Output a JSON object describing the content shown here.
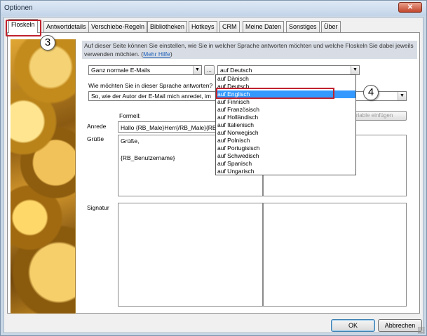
{
  "window": {
    "title": "Optionen",
    "close_glyph": "✕"
  },
  "tabs": [
    "Floskeln",
    "Antwortdetails",
    "Verschiebe-Regeln",
    "Bibliotheken",
    "Hotkeys",
    "CRM",
    "Meine Daten",
    "Sonstiges",
    "Über"
  ],
  "active_tab": "Floskeln",
  "callouts": {
    "step3": "3",
    "step4": "4"
  },
  "info": {
    "text": "Auf dieser Seite können Sie einstellen, wie Sie in welcher Sprache antworten möchten und welche Floskeln Sie dabei jeweils verwenden möchten.",
    "link": "Mehr Hilfe"
  },
  "style_combo": {
    "value": "Ganz normale E-Mails",
    "ellipsis_button": "..."
  },
  "language_combo": {
    "value": "auf Deutsch"
  },
  "question_label": "Wie möchten Sie in dieser Sprache antworten?",
  "address_combo": {
    "value": "So, wie der Autor der E-Mail mich anredet, im"
  },
  "insert_variable_button": "Variable einfügen",
  "column_label_formal": "Formell:",
  "row_labels": {
    "salutation": "Anrede",
    "greeting": "Grüße",
    "signature": "Signatur"
  },
  "salutation_value": "Hallo {RB_Male}Herr{/RB_Male}{RB",
  "greeting_lines": [
    "Grüße,",
    "",
    "{RB_Benutzername}"
  ],
  "language_options": [
    "auf Dänisch",
    "auf Deutsch",
    "auf Englisch",
    "auf Finnisch",
    "auf Französisch",
    "auf Holländisch",
    "auf Italienisch",
    "auf Norwegisch",
    "auf Polnisch",
    "auf Portugisisch",
    "auf Schwedisch",
    "auf Spanisch",
    "auf Ungarisch"
  ],
  "selected_language": "auf Englisch",
  "buttons": {
    "ok": "OK",
    "cancel": "Abbrechen"
  },
  "colors": {
    "highlight": "#3399ff",
    "callout": "#c0212d",
    "link": "#1d5fb8"
  }
}
